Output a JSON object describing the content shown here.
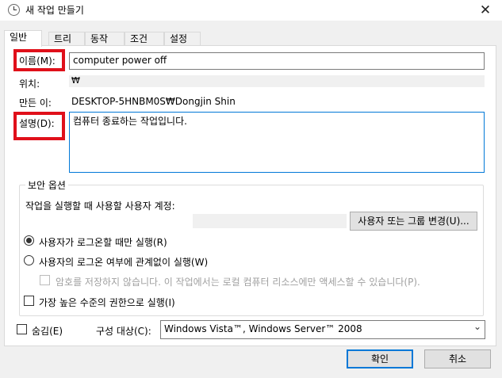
{
  "window": {
    "title": "새 작업 만들기",
    "close_glyph": "✕"
  },
  "tabs": [
    {
      "label": "일반"
    },
    {
      "label": "트리거"
    },
    {
      "label": "동작"
    },
    {
      "label": "조건"
    },
    {
      "label": "설정"
    }
  ],
  "general": {
    "name_label": "이름(M):",
    "name_value": "computer power off",
    "location_label": "위치:",
    "location_value": "₩",
    "author_label": "만든 이:",
    "author_value": "DESKTOP-5HNBM0S₩Dongjin Shin",
    "description_label": "설명(D):",
    "description_value": "컴퓨터 종료하는 작업입니다."
  },
  "security": {
    "group_title": "보안 옵션",
    "run_as_label": "작업을 실행할 때 사용할 사용자 계정:",
    "change_user_button": "사용자 또는 그룹 변경(U)...",
    "radio_logged_on": "사용자가 로그온할 때만 실행(R)",
    "radio_whether_logged": "사용자의 로그온 여부에 관계없이 실행(W)",
    "no_store_password": "암호를 저장하지 않습니다. 이 작업에서는 로컬 컴퓨터 리소스에만 액세스할 수 있습니다(P).",
    "highest_privileges": "가장 높은 수준의 권한으로 실행(I)"
  },
  "bottom": {
    "hidden_label": "숨김(E)",
    "configure_label": "구성 대상(C):",
    "configure_value": "Windows Vista™, Windows Server™ 2008",
    "ok_button": "확인",
    "cancel_button": "취소"
  },
  "colors": {
    "highlight_box": "#e0101a",
    "focus_border": "#0078d7"
  }
}
